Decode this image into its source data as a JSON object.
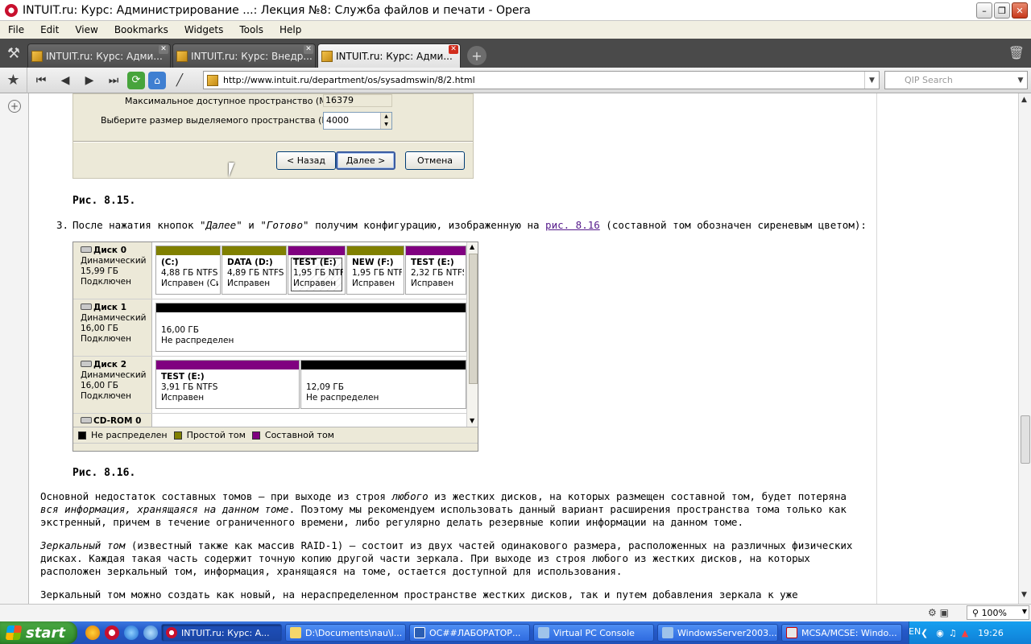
{
  "window": {
    "title": "INTUIT.ru: Курс: Администрирование ...: Лекция №8: Служба файлов и печати - Opera"
  },
  "menu": [
    "File",
    "Edit",
    "View",
    "Bookmarks",
    "Widgets",
    "Tools",
    "Help"
  ],
  "tabs": [
    {
      "label": "INTUIT.ru: Курс: Адми...",
      "active": false
    },
    {
      "label": "INTUIT.ru: Курс: Внедр...",
      "active": false
    },
    {
      "label": "INTUIT.ru: Курс: Адми...",
      "active": true
    }
  ],
  "address": {
    "url": "http://www.intuit.ru/department/os/sysadmswin/8/2.html"
  },
  "search": {
    "placeholder": "QIP Search"
  },
  "dialog": {
    "max_space_label": "Максимальное доступное пространство (МБ):",
    "max_space_value": "16379",
    "size_label": "Выберите размер выделяемого пространства (МБ):",
    "size_value": "4000",
    "back_button": "< Назад",
    "next_button": "Далее >",
    "cancel_button": "Отмена"
  },
  "captions": {
    "fig15": "Рис. 8.15.",
    "fig16": "Рис. 8.16."
  },
  "step3": {
    "number": "3.",
    "text_before": "После нажатия кнопок \"",
    "next": "Далее",
    "and": "\" и \"",
    "done": "Готово",
    "text_mid": "\" получим конфигурацию, изображенную на ",
    "link": "рис. 8.16",
    "text_after": " (составной том обозначен сиреневым цветом):"
  },
  "disk_management": {
    "colors": {
      "unallocated": "#000000",
      "simple": "#808000",
      "spanned": "#800080"
    },
    "disks": [
      {
        "name": "Диск 0",
        "type": "Динамический",
        "size": "15,99 ГБ",
        "status": "Подключен",
        "partitions": [
          {
            "title": "(C:)",
            "line2": "4,88 ГБ NTFS",
            "line3": "Исправен (Си",
            "kind": "simple"
          },
          {
            "title": "DATA  (D:)",
            "line2": "4,89 ГБ NTFS",
            "line3": "Исправен",
            "kind": "simple"
          },
          {
            "title": "TEST  (E:)",
            "line2": "1,95 ГБ NTF",
            "line3": "Исправен",
            "kind": "spanned"
          },
          {
            "title": "NEW  (F:)",
            "line2": "1,95 ГБ NTF",
            "line3": "Исправен",
            "kind": "simple"
          },
          {
            "title": "TEST  (E:)",
            "line2": "2,32 ГБ NTFS",
            "line3": "Исправен",
            "kind": "spanned"
          }
        ]
      },
      {
        "name": "Диск 1",
        "type": "Динамический",
        "size": "16,00 ГБ",
        "status": "Подключен",
        "partitions": [
          {
            "title": "",
            "line2": "16,00 ГБ",
            "line3": "Не распределен",
            "kind": "unallocated"
          }
        ]
      },
      {
        "name": "Диск 2",
        "type": "Динамический",
        "size": "16,00 ГБ",
        "status": "Подключен",
        "partitions": [
          {
            "title": "TEST  (E:)",
            "line2": "3,91 ГБ NTFS",
            "line3": "Исправен",
            "kind": "spanned"
          },
          {
            "title": "",
            "line2": "12,09 ГБ",
            "line3": "Не распределен",
            "kind": "unallocated"
          }
        ]
      }
    ],
    "cdrom": "CD-ROM 0",
    "legend": [
      "Не распределен",
      "Простой том",
      "Составной том"
    ]
  },
  "paragraphs": {
    "p1_a": "Основной недостаток составных томов — при выходе из строя ",
    "p1_b": "любого",
    "p1_c": " из жестких дисков, на которых размещен составной том, будет потеряна",
    "p1_d": "вся информация, хранящаяся на данном томе",
    "p1_e": ". Поэтому мы рекомендуем использовать данный вариант расширения пространства тома только как",
    "p1_f": "экстренный, причем в течение ограниченного времени, либо регулярно делать резервные копии информации на данном томе.",
    "p2_a": "Зеркальный том",
    "p2_b": " (известный также как массив RAID-1) — состоит из двух частей одинакового размера, расположенных на различных физических",
    "p2_c": "дисках. Каждая такая часть содержит точную копию другой части зеркала. При выходе из строя любого из жестких дисков, на которых",
    "p2_d": "расположен зеркальный том, информация, хранящаяся на томе, остается доступной для использования.",
    "p3": "Зеркальный том можно создать как новый, на нераспределенном пространстве жестких дисков, так и путем добавления зеркала к уже"
  },
  "status": {
    "zoom": "100%"
  },
  "taskbar": {
    "start": "start",
    "tasks": [
      {
        "label": "INTUIT.ru: Курс: А...",
        "active": true
      },
      {
        "label": "D:\\Documents\\nau\\l...",
        "active": false
      },
      {
        "label": "ОС##ЛАБОРАТОР...",
        "active": false
      },
      {
        "label": "Virtual PC Console",
        "active": false
      },
      {
        "label": "WindowsServer2003...",
        "active": false
      },
      {
        "label": "MCSA/MCSE: Windo...",
        "active": false
      }
    ],
    "language": "EN",
    "clock": "19:26"
  }
}
